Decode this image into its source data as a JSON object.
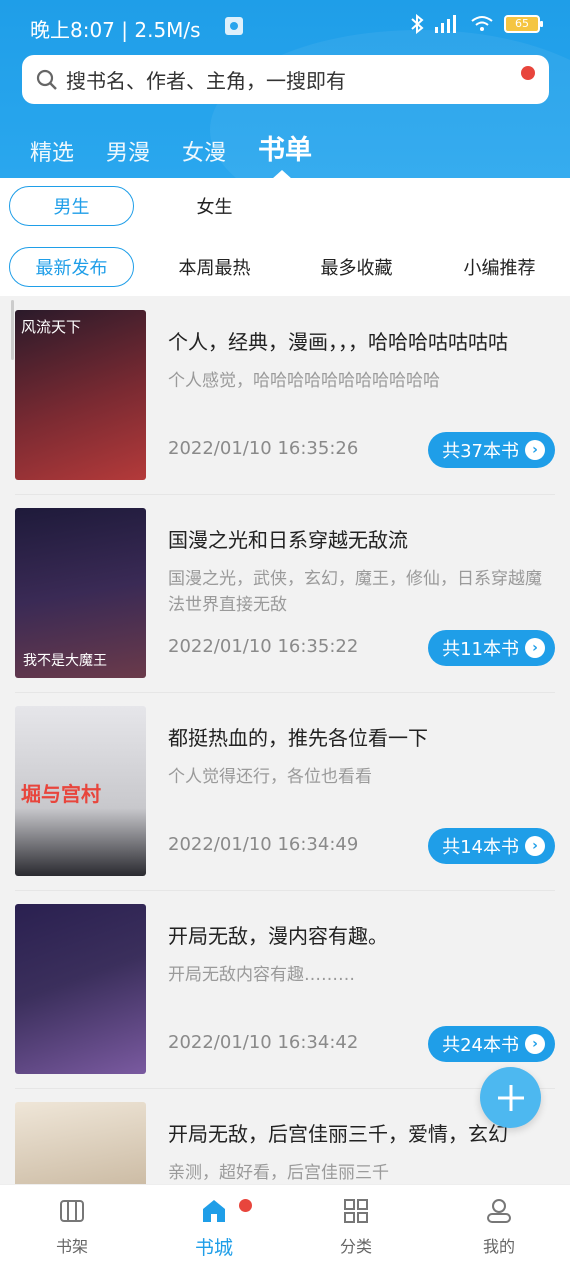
{
  "status_bar": {
    "time": "晚上8:07 | 2.5M/s",
    "battery": "65"
  },
  "search": {
    "placeholder": "搜书名、作者、主角，一搜即有"
  },
  "tabs": [
    {
      "label": "精选"
    },
    {
      "label": "男漫"
    },
    {
      "label": "女漫"
    },
    {
      "label": "书单",
      "active": true
    }
  ],
  "gender_filters": [
    {
      "label": "男生",
      "active": true
    },
    {
      "label": "女生"
    }
  ],
  "sort_filters": [
    {
      "label": "最新发布",
      "active": true
    },
    {
      "label": "本周最热"
    },
    {
      "label": "最多收藏"
    },
    {
      "label": "小编推荐"
    }
  ],
  "booklists": [
    {
      "title": "个人，经典，漫画，，，哈哈哈咕咕咕咕",
      "desc": "个人感觉，哈哈哈哈哈哈哈哈哈哈哈",
      "date": "2022/01/10 16:35:26",
      "count": "共37本书"
    },
    {
      "title": "国漫之光和日系穿越无敌流",
      "desc": "国漫之光，武侠，玄幻，魔王，修仙，日系穿越魔法世界直接无敌",
      "date": "2022/01/10 16:35:22",
      "count": "共11本书"
    },
    {
      "title": "都挺热血的，推先各位看一下",
      "desc": "个人觉得还行，各位也看看",
      "date": "2022/01/10 16:34:49",
      "count": "共14本书"
    },
    {
      "title": "开局无敌，漫内容有趣。",
      "desc": "开局无敌内容有趣………",
      "date": "2022/01/10 16:34:42",
      "count": "共24本书"
    },
    {
      "title": "开局无敌，后宫佳丽三千，爱情，玄幻",
      "desc": "亲测，超好看，后宫佳丽三千",
      "date": "",
      "count": ""
    }
  ],
  "covers": [
    {
      "text": "风流天下",
      "color": "#7a2a32"
    },
    {
      "text": "我不是大魔王",
      "color": "#3a2a55"
    },
    {
      "text": "堀与宫村",
      "color": "#c8c8cc"
    },
    {
      "text": "",
      "color": "#3b2f5c"
    },
    {
      "text": "",
      "color": "#c9b8a0"
    }
  ],
  "bottom_nav": [
    {
      "label": "书架",
      "icon": "bookshelf-icon"
    },
    {
      "label": "书城",
      "icon": "home-icon",
      "active": true
    },
    {
      "label": "分类",
      "icon": "grid-icon"
    },
    {
      "label": "我的",
      "icon": "person-icon"
    }
  ]
}
